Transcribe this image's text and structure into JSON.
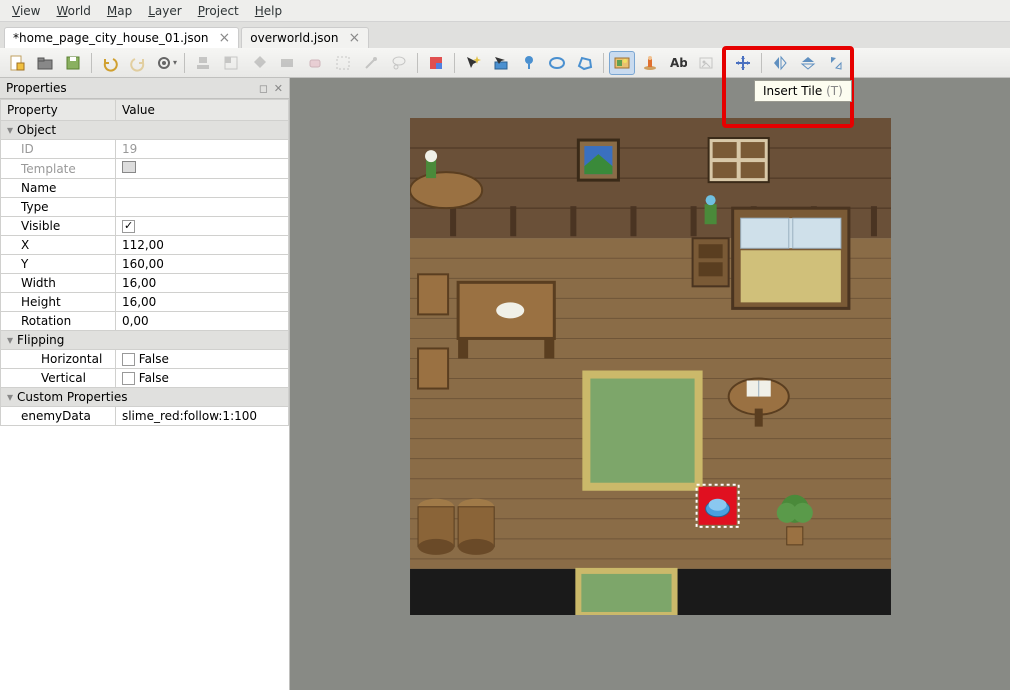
{
  "menubar": [
    "View",
    "World",
    "Map",
    "Layer",
    "Project",
    "Help"
  ],
  "tabs": [
    {
      "label": "*home_page_city_house_01.json",
      "active": true
    },
    {
      "label": "overworld.json",
      "active": false
    }
  ],
  "toolbar": {
    "new": "new-file",
    "open": "open-file",
    "save": "save-file",
    "undo": "undo",
    "redo": "redo",
    "command": "command",
    "stamp": "stamp-tool",
    "terrain": "terrain-tool",
    "fill": "fill-tool",
    "shape": "shape-tool",
    "eraser": "eraser-tool",
    "select_rect": "select-rect",
    "wand": "wand-tool",
    "lasso": "lasso-tool",
    "edit_obj": "edit-object",
    "select_obj": "select-object",
    "insert_rect": "insert-rect",
    "insert_point": "insert-point",
    "insert_ellipse": "insert-ellipse",
    "insert_polygon": "insert-polygon",
    "insert_tile": "insert-tile",
    "insert_template": "insert-template",
    "insert_text": "insert-text",
    "insert_image": "insert-image",
    "move": "move-tool",
    "flip_h": "flip-h",
    "flip_v": "flip-v",
    "rotate": "rotate"
  },
  "tooltip": {
    "label": "Insert Tile",
    "shortcut": "(T)"
  },
  "panel": {
    "title": "Properties",
    "columns": {
      "prop": "Property",
      "val": "Value"
    },
    "sections": {
      "object": "Object",
      "flipping": "Flipping",
      "custom": "Custom Properties"
    },
    "rows": {
      "id": {
        "label": "ID",
        "value": "19",
        "disabled": true
      },
      "template": {
        "label": "Template",
        "value": "",
        "icon": true,
        "disabled": true
      },
      "name": {
        "label": "Name",
        "value": ""
      },
      "type": {
        "label": "Type",
        "value": ""
      },
      "visible": {
        "label": "Visible",
        "checked": true
      },
      "x": {
        "label": "X",
        "value": "112,00"
      },
      "y": {
        "label": "Y",
        "value": "160,00"
      },
      "width": {
        "label": "Width",
        "value": "16,00"
      },
      "height": {
        "label": "Height",
        "value": "16,00"
      },
      "rotation": {
        "label": "Rotation",
        "value": "0,00"
      },
      "horizontal": {
        "label": "Horizontal",
        "checked": false,
        "text": "False"
      },
      "vertical": {
        "label": "Vertical",
        "checked": false,
        "text": "False"
      },
      "enemyData": {
        "label": "enemyData",
        "value": "slime_red:follow:1:100"
      }
    }
  },
  "map": {
    "bg_wall": "#6a5038",
    "bg_floor": "#8a6c47",
    "brick_line": "#6f5538",
    "carpet": "#7da66a",
    "carpet_border": "#cbb96a",
    "bed_frame": "#7a5a36",
    "bed_sheet": "#d0c07a",
    "pillow": "#cfe0ea",
    "table": "#9a7142",
    "plate": "#f0f0e8",
    "barrel": "#8a6438",
    "plant": "#4a8a3a",
    "selection_border": "#ffffff",
    "selection_fill": "#e01020",
    "slime": "#4aa0e0",
    "black": "#1a1a1a"
  }
}
